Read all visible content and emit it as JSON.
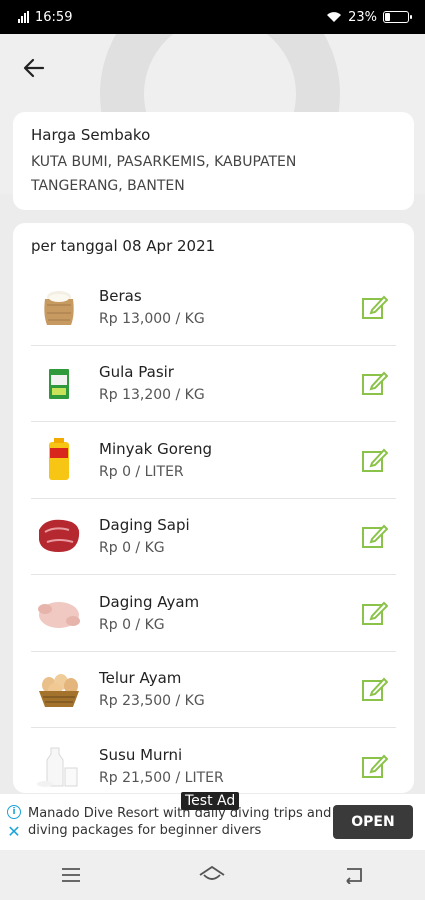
{
  "status_bar": {
    "time": "16:59",
    "network": "4G",
    "battery_text": "23%",
    "battery_level": 0.23
  },
  "header": {
    "back_icon": "arrow-left-icon"
  },
  "info_card": {
    "title": "Harga Sembako",
    "location": "KUTA BUMI, PASARKEMIS, KABUPATEN TANGERANG, BANTEN"
  },
  "list": {
    "date_label": "per tanggal 08 Apr 2021",
    "items": [
      {
        "name": "Beras",
        "price": "Rp 13,000 / KG",
        "icon": "rice-sack-icon"
      },
      {
        "name": "Gula Pasir",
        "price": "Rp 13,200 / KG",
        "icon": "sugar-pack-icon"
      },
      {
        "name": "Minyak Goreng",
        "price": "Rp 0 / LITER",
        "icon": "cooking-oil-icon"
      },
      {
        "name": "Daging Sapi",
        "price": "Rp 0 / KG",
        "icon": "beef-icon"
      },
      {
        "name": "Daging Ayam",
        "price": "Rp 0 / KG",
        "icon": "chicken-icon"
      },
      {
        "name": "Telur Ayam",
        "price": "Rp 23,500 / KG",
        "icon": "egg-basket-icon"
      },
      {
        "name": "Susu Murni",
        "price": "Rp 21,500 / LITER",
        "icon": "milk-icon"
      }
    ],
    "edit_icon": "edit-icon"
  },
  "ad": {
    "label": "Test Ad",
    "text": "Manado Dive Resort with daily diving trips and diving packages for beginner divers",
    "cta": "OPEN"
  },
  "colors": {
    "accent_green": "#8bc34a",
    "ad_blue": "#1ca3d8"
  }
}
